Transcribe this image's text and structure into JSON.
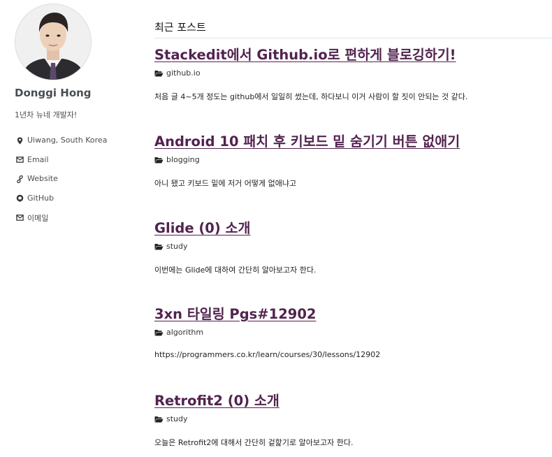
{
  "sidebar": {
    "author_name": "Donggi Hong",
    "author_bio": "1년차 뉴네 개발자!",
    "links": [
      {
        "icon": "location-pin-icon",
        "label": "Uiwang, South Korea"
      },
      {
        "icon": "envelope-icon",
        "label": "Email"
      },
      {
        "icon": "link-icon",
        "label": "Website"
      },
      {
        "icon": "github-icon",
        "label": "GitHub"
      },
      {
        "icon": "envelope-icon",
        "label": "이메일"
      }
    ]
  },
  "main": {
    "section_title": "최근 포스트",
    "posts": [
      {
        "title": "Stackedit에서 Github.io로 편하게 블로깅하기!",
        "category": "github.io",
        "excerpt": "처음 글 4~5개 정도는 github에서 일일히 썼는데, 하다보니 이거 사람이 할 짓이 안되는 것 같다."
      },
      {
        "title": "Android 10 패치 후 키보드 밑 숨기기 버튼 없애기",
        "category": "blogging",
        "excerpt": "아니 됐고 키보드 밑에 저거 어떻게 없애냐고"
      },
      {
        "title": "Glide (0) 소개",
        "category": "study",
        "excerpt": "이번에는 Glide에 대하여 간단히 알아보고자 한다."
      },
      {
        "title": "3xn 타일링 Pgs#12902",
        "category": "algorithm",
        "excerpt": "https://programmers.co.kr/learn/courses/30/lessons/12902"
      },
      {
        "title": "Retrofit2 (0) 소개",
        "category": "study",
        "excerpt": "오늘은 Retrofit2에 대해서 간단히 겉핥기로 알아보고자 한다."
      }
    ]
  },
  "colors": {
    "post_title": "#52234f",
    "sidebar_text": "#494e52",
    "rule": "#e2e4e6"
  }
}
